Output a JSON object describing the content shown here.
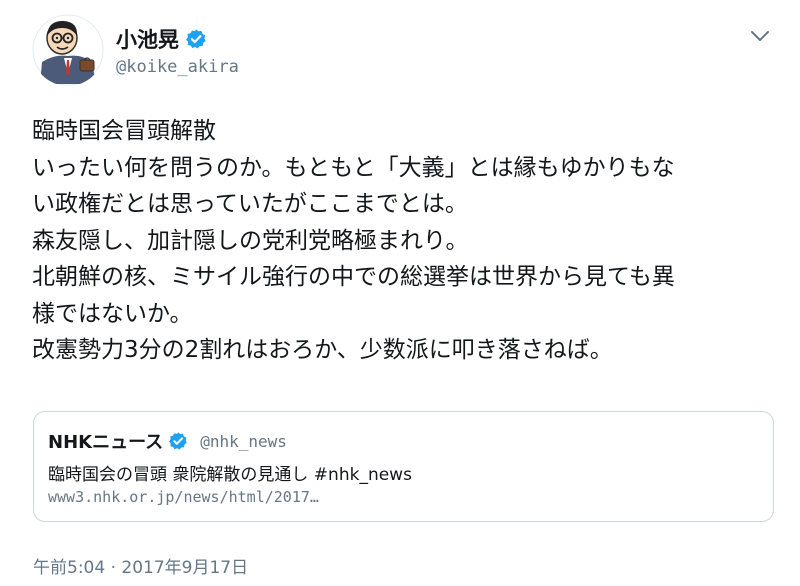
{
  "author": {
    "name": "小池晃",
    "handle": "@koike_akira",
    "verified": true
  },
  "tweet": {
    "lines": [
      "臨時国会冒頭解散",
      "いったい何を問うのか。もともと「大義」とは縁もゆかりもな",
      "い政権だとは思っていたがここまでとは。",
      "森友隠し、加計隠しの党利党略極まれり。",
      "北朝鮮の核、ミサイル強行の中での総選挙は世界から見ても異",
      "様ではないか。",
      "改憲勢力3分の2割れはおろか、少数派に叩き落さねば。"
    ]
  },
  "quoted": {
    "name": "NHKニュース",
    "handle": "@nhk_news",
    "verified": true,
    "title": "臨時国会の冒頭 衆院解散の見通し #nhk_news",
    "url": "www3.nhk.or.jp/news/html/2017…"
  },
  "timestamp": "午前5:04 · 2017年9月17日",
  "colors": {
    "verified": "#1da1f2",
    "secondary_text": "#657786",
    "border": "#ccd6dd"
  }
}
